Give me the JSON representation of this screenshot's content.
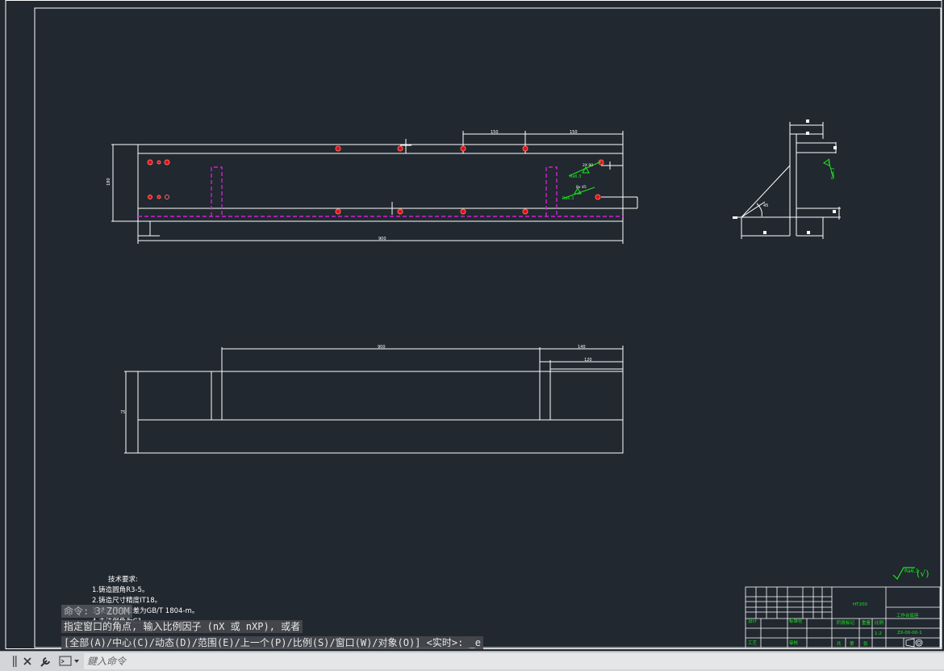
{
  "drawing": {
    "dims": {
      "d_top_left": "150",
      "d_top_right": "150",
      "d_height": "180",
      "d_length": "900",
      "d_side_45": "45",
      "d_bottom_long": "900",
      "d_bottom_right": "140",
      "d_bottom_inner": "120",
      "d_bottom_height": "75"
    },
    "weld_labels": {
      "w1": "2X 90",
      "w2": "8x 45",
      "w3": "Ra6.3",
      "w4": "Ra6.3",
      "w5": "Ra6.3"
    },
    "tech_requirements": {
      "title": "技术要求:",
      "item1": "1.铸造圆角R3-5。",
      "item2": "2.铸造尺寸精度IT18。",
      "item3": "3.未注尺寸公差为GB/T 1804-m。",
      "item4": "4.未注倒角为C1。"
    },
    "roughness_symbol": "Ra6.3",
    "roughness_suffix": "(√)",
    "title_block": {
      "material": "HT200",
      "part_name": "工作台底座",
      "drawing_no": "ZX-00-00-1",
      "design": "设计",
      "review": "审核",
      "process": "工艺",
      "standard": "标准化",
      "stage_mark": "阶段标记",
      "weight": "重量",
      "scale": "比例",
      "scale_val": "1:2",
      "sheet_total": "共",
      "sheet_no": "第",
      "sheet": "张"
    }
  },
  "command": {
    "history_line1": "命令: 3'ZOOM",
    "history_line2": "指定窗口的角点, 输入比例因子 (nX 或 nXP), 或者",
    "history_line3": "[全部(A)/中心(C)/动态(D)/范围(E)/上一个(P)/比例(S)/窗口(W)/对象(O)] <实时>: _e",
    "input_placeholder": "鍵入命令"
  },
  "colors": {
    "background": "#212830",
    "line": "#ffffff",
    "hidden_line": "#d21fd2",
    "weld_symbol": "#1ee81e",
    "hole": "#e01010"
  }
}
